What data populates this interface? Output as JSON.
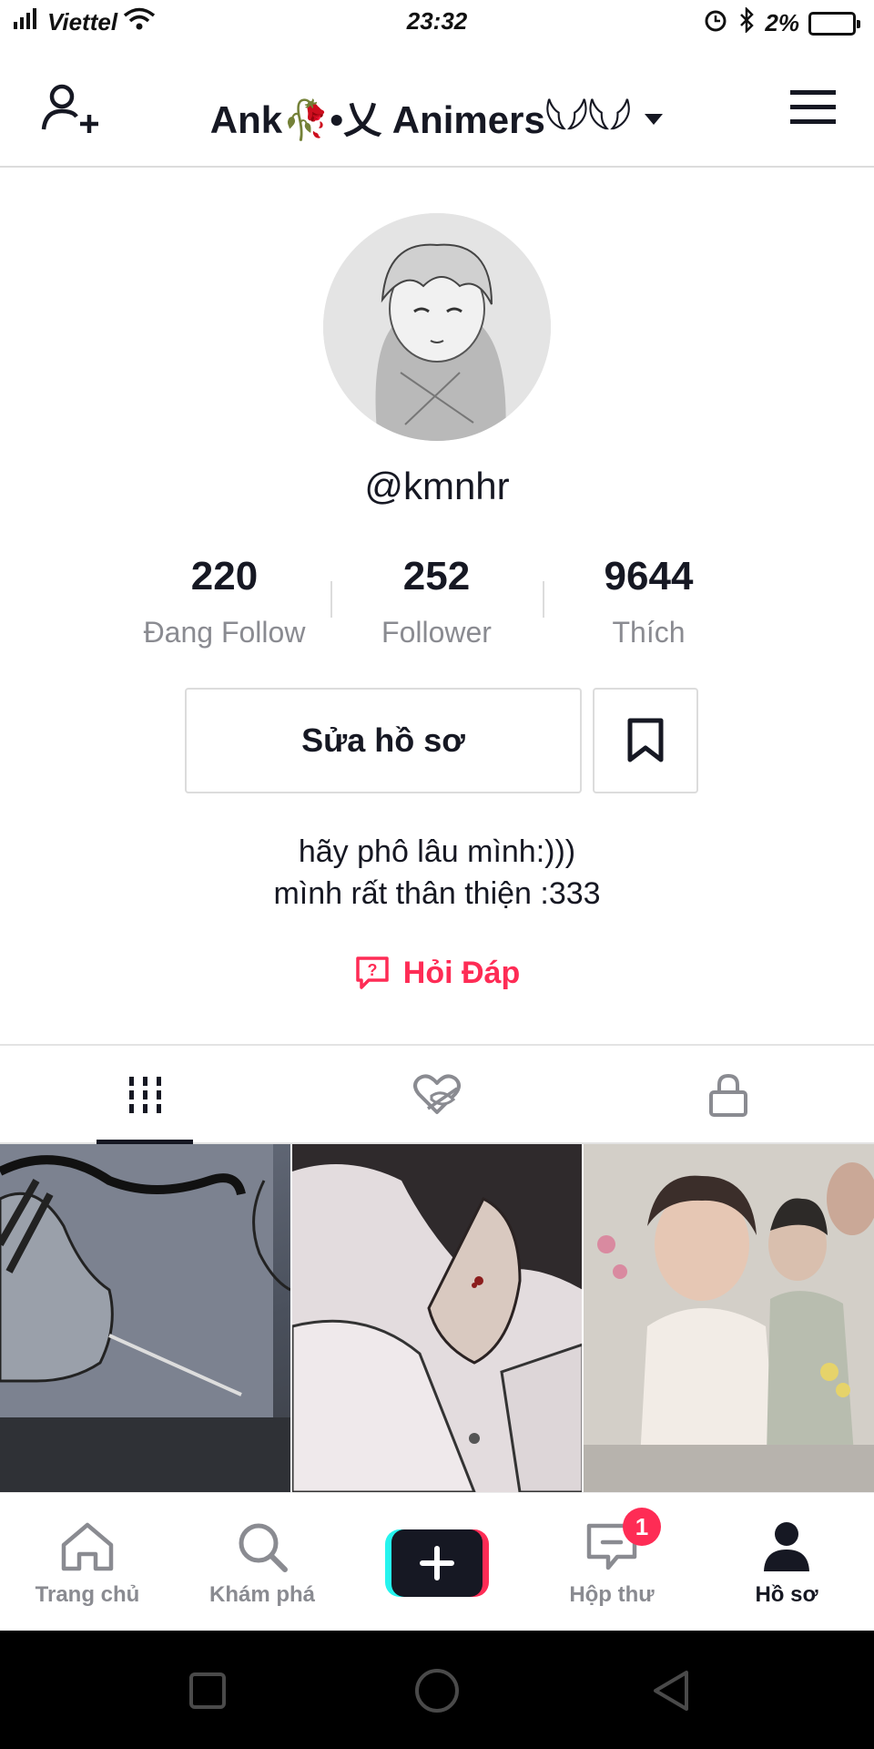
{
  "status_bar": {
    "carrier": "Viettel",
    "time": "23:32",
    "battery": "2%"
  },
  "header": {
    "account_name": "Ank🥀•乂 Animers𓆩𓆪𓆩𓆪"
  },
  "profile": {
    "handle": "@kmnhr",
    "stats": [
      {
        "value": "220",
        "label": "Đang Follow"
      },
      {
        "value": "252",
        "label": "Follower"
      },
      {
        "value": "9644",
        "label": "Thích"
      }
    ],
    "edit_label": "Sửa hồ sơ",
    "bio_line1": "hãy phô lâu mình:)))",
    "bio_line2": "mình rất thân thiện :333",
    "qa_label": "Hỏi Đáp"
  },
  "tabs": [
    {
      "icon": "grid-icon",
      "active": true
    },
    {
      "icon": "liked-hidden-icon",
      "active": false
    },
    {
      "icon": "lock-icon",
      "active": false
    }
  ],
  "bottom_nav": {
    "items": [
      {
        "label": "Trang chủ",
        "icon": "home-icon"
      },
      {
        "label": "Khám phá",
        "icon": "search-icon"
      },
      {
        "label": "",
        "icon": "plus-icon"
      },
      {
        "label": "Hộp thư",
        "icon": "inbox-icon",
        "badge": "1"
      },
      {
        "label": "Hồ sơ",
        "icon": "profile-icon",
        "active": true
      }
    ]
  },
  "colors": {
    "accent": "#fe2c55",
    "cyan": "#25f4ee",
    "text_primary": "#161823",
    "text_secondary": "#8a8b91"
  }
}
